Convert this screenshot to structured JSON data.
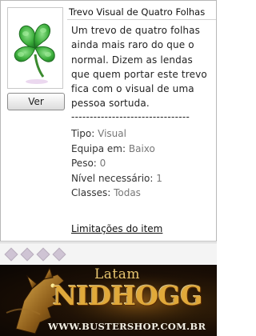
{
  "item": {
    "title": "Trevo Visual de Quatro Folhas",
    "icon": "four-leaf-clover-icon",
    "view_button": "Ver",
    "description_lines": [
      "Um trevo de quatro folhas",
      "ainda mais raro do que o",
      "normal. Dizem as lendas",
      "que quem portar este trevo",
      "fica com o visual de uma",
      "pessoa sortuda."
    ],
    "separator": "--------------------------------",
    "properties": [
      {
        "label": "Tipo:",
        "value": "Visual"
      },
      {
        "label": "Equipa em:",
        "value": "Baixo"
      },
      {
        "label": "Peso:",
        "value": "0"
      },
      {
        "label": "Nível necessário:",
        "value": "1"
      },
      {
        "label": "Classes:",
        "value": "Todas"
      }
    ],
    "limits_link": "Limitações do item"
  },
  "banner": {
    "latam": "Latam",
    "title": "NIDHOGG",
    "url": "WWW.BUSTERSHOP.COM.BR"
  },
  "colors": {
    "clover": "#3cae3c",
    "banner_gold": "#e0a93a",
    "value_gray": "#777777"
  }
}
